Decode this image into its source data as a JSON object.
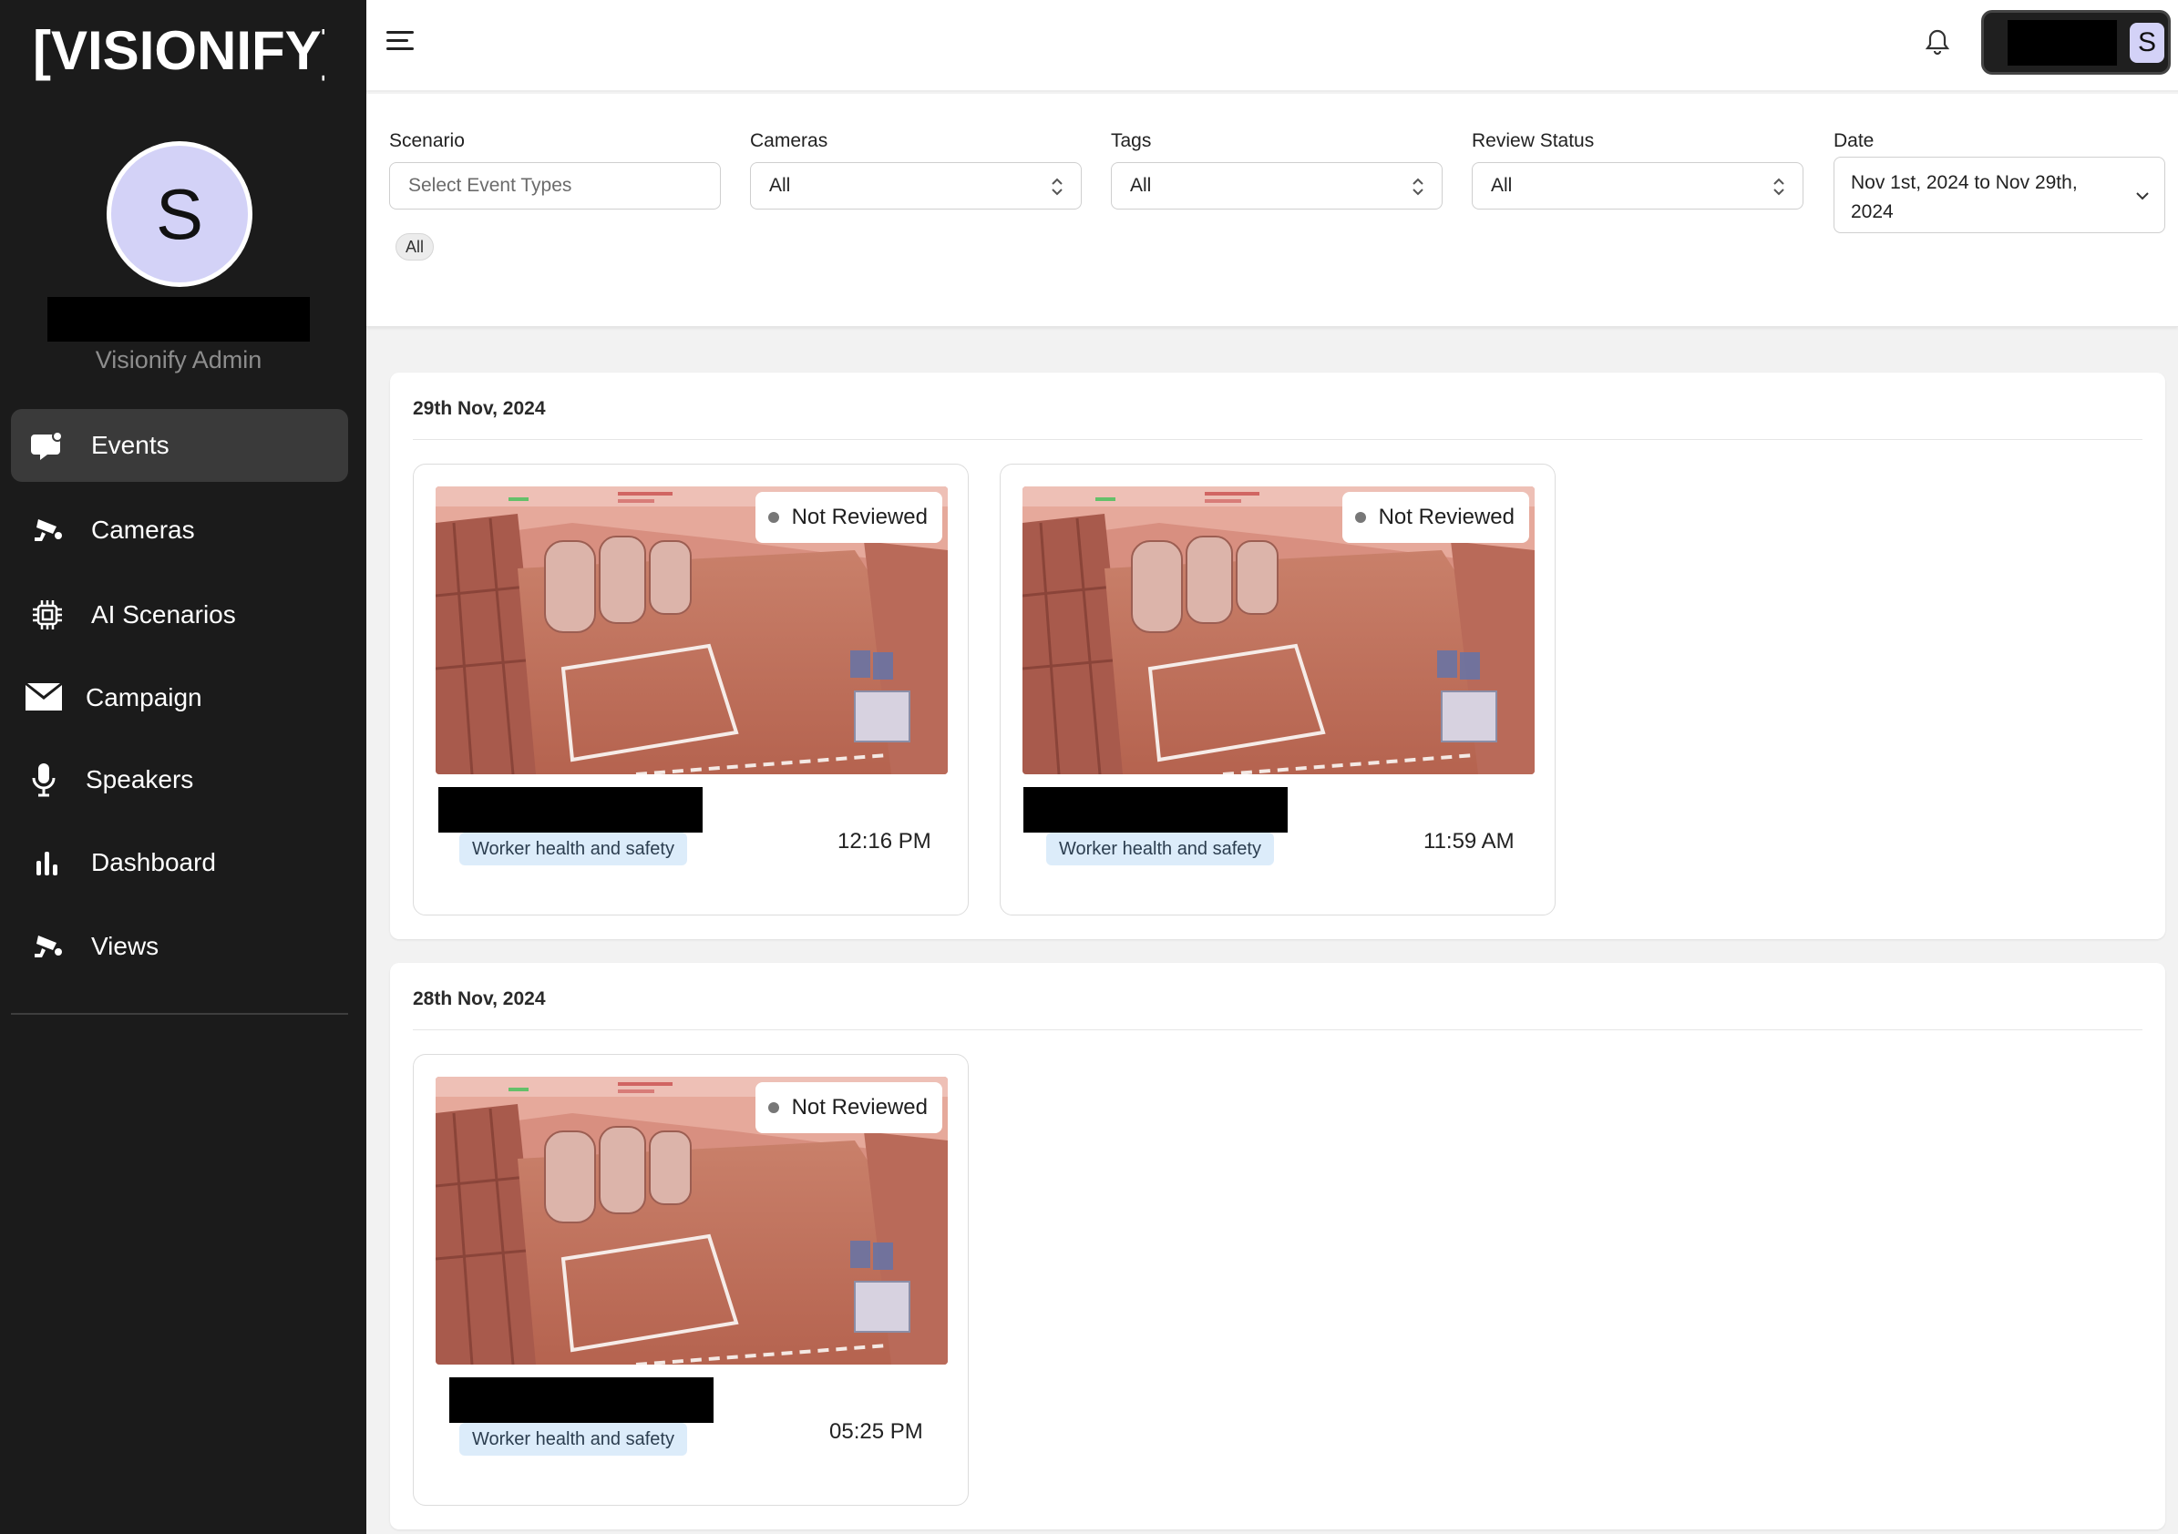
{
  "app": {
    "brand": "[VISIONIFY]",
    "user_initial": "S",
    "user_role": "Visionify Admin"
  },
  "sidebar": {
    "items": [
      {
        "label": "Events",
        "icon": "events-icon",
        "active": true
      },
      {
        "label": "Cameras",
        "icon": "camera-icon",
        "active": false
      },
      {
        "label": "AI Scenarios",
        "icon": "chip-icon",
        "active": false
      },
      {
        "label": "Campaign",
        "icon": "mail-icon",
        "active": false
      },
      {
        "label": "Speakers",
        "icon": "microphone-icon",
        "active": false
      },
      {
        "label": "Dashboard",
        "icon": "bar-chart-icon",
        "active": false
      },
      {
        "label": "Views",
        "icon": "camera-icon",
        "active": false
      }
    ]
  },
  "header": {
    "user_initial": "S"
  },
  "filters": {
    "scenario": {
      "label": "Scenario",
      "placeholder": "Select Event Types",
      "chip": "All"
    },
    "cameras": {
      "label": "Cameras",
      "value": "All"
    },
    "tags": {
      "label": "Tags",
      "value": "All"
    },
    "review_status": {
      "label": "Review Status",
      "value": "All"
    },
    "date": {
      "label": "Date",
      "value": "Nov 1st, 2024 to Nov 29th, 2024"
    }
  },
  "sections": [
    {
      "date": "29th Nov, 2024",
      "events": [
        {
          "status": "Not Reviewed",
          "tag": "Worker health and safety",
          "time": "12:16 PM"
        },
        {
          "status": "Not Reviewed",
          "tag": "Worker health and safety",
          "time": "11:59 AM"
        }
      ]
    },
    {
      "date": "28th Nov, 2024",
      "events": [
        {
          "status": "Not Reviewed",
          "tag": "Worker health and safety",
          "time": "05:25 PM"
        }
      ]
    }
  ],
  "colors": {
    "sidebar_bg": "#1b1b1b",
    "active_item_bg": "#3a3a3a",
    "avatar_bg": "#d3d2f7",
    "tag_bg": "#dcecfa",
    "status_dot": "#777777"
  }
}
